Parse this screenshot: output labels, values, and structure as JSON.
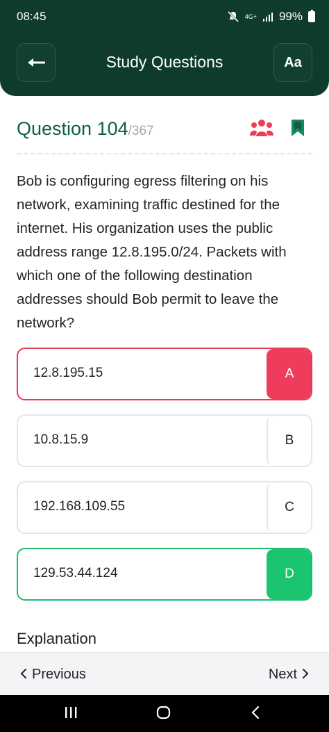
{
  "status_bar": {
    "time": "08:45",
    "network": "4G+",
    "battery": "99%"
  },
  "header": {
    "title": "Study Questions",
    "font_button_label": "Aa",
    "bg_color": "#0f3b2b"
  },
  "question": {
    "label": "Question 104",
    "total": "/367",
    "text": "Bob is configuring egress filtering on his network, examining traffic destined for the internet. His organization uses the public address range 12.8.195.0/24. Packets with which one of the following destination addresses should Bob permit to leave the network?"
  },
  "options": [
    {
      "letter": "A",
      "value": "12.8.195.15",
      "state": "wrong"
    },
    {
      "letter": "B",
      "value": "10.8.15.9",
      "state": "neutral"
    },
    {
      "letter": "C",
      "value": "192.168.109.55",
      "state": "neutral"
    },
    {
      "letter": "D",
      "value": "129.53.44.124",
      "state": "correct"
    }
  ],
  "explanation_heading": "Explanation",
  "footer": {
    "previous": "Previous",
    "next": "Next"
  },
  "colors": {
    "accent_green": "#0f5f45",
    "wrong_red": "#ef3c5c",
    "correct_green": "#1bc46f"
  },
  "icons": [
    "back-arrow-icon",
    "users-group-icon",
    "bookmark-icon",
    "chevron-left-icon",
    "chevron-right-icon",
    "mute-icon",
    "signal-icon",
    "battery-icon"
  ]
}
